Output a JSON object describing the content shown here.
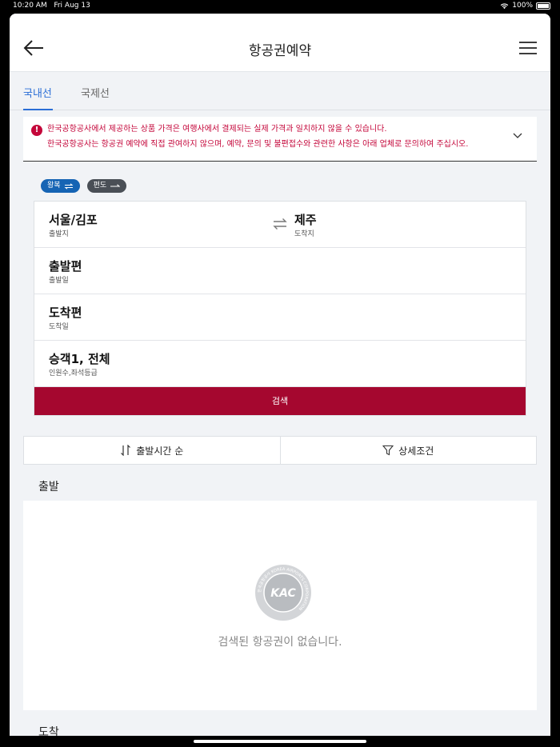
{
  "status_bar": {
    "time": "10:20 AM",
    "date": "Fri Aug 13",
    "battery": "100%"
  },
  "header": {
    "title": "항공권예약",
    "back_icon": "arrow-left-icon",
    "menu_icon": "hamburger-icon"
  },
  "tabs": [
    {
      "label": "국내선",
      "active": true
    },
    {
      "label": "국제선",
      "active": false
    }
  ],
  "notice": {
    "line1": "한국공항공사에서 제공하는 상품 가격은 여행사에서 결제되는 실제 가격과 일치하지 않을 수 있습니다.",
    "line2": "한국공항공사는 항공권 예약에 직접 관여하지 않으며, 예약, 문의 및 불편접수와 관련한 사항은 아래 업체로 문의하여 주십시오.",
    "color": "#c4063a"
  },
  "trip_types": [
    {
      "label": "왕복",
      "icon": "swap-arrows-icon",
      "selected": true
    },
    {
      "label": "편도",
      "icon": "arrow-right-icon",
      "selected": false
    }
  ],
  "form": {
    "origin": {
      "value": "서울/김포",
      "label": "출발지"
    },
    "destination": {
      "value": "제주",
      "label": "도착지"
    },
    "departure": {
      "value": "출발편",
      "label": "출발일"
    },
    "arrival": {
      "value": "도착편",
      "label": "도착일"
    },
    "passengers": {
      "value": "승객1, 전체",
      "label": "인원수,좌석등급"
    },
    "search_label": "검색",
    "accent": "#a5072f"
  },
  "sort": {
    "label": "출발시간 순",
    "icon": "sort-arrows-icon"
  },
  "filter": {
    "label": "상세조건",
    "icon": "filter-icon"
  },
  "departure_section": {
    "title": "출발",
    "empty_text": "검색된 항공권이 없습니다.",
    "logo_text": "KAC",
    "logo_ring_text": "한국공항공사 KOREA AIRPORTS CORPORATION"
  },
  "arrival_section": {
    "title": "도착"
  }
}
